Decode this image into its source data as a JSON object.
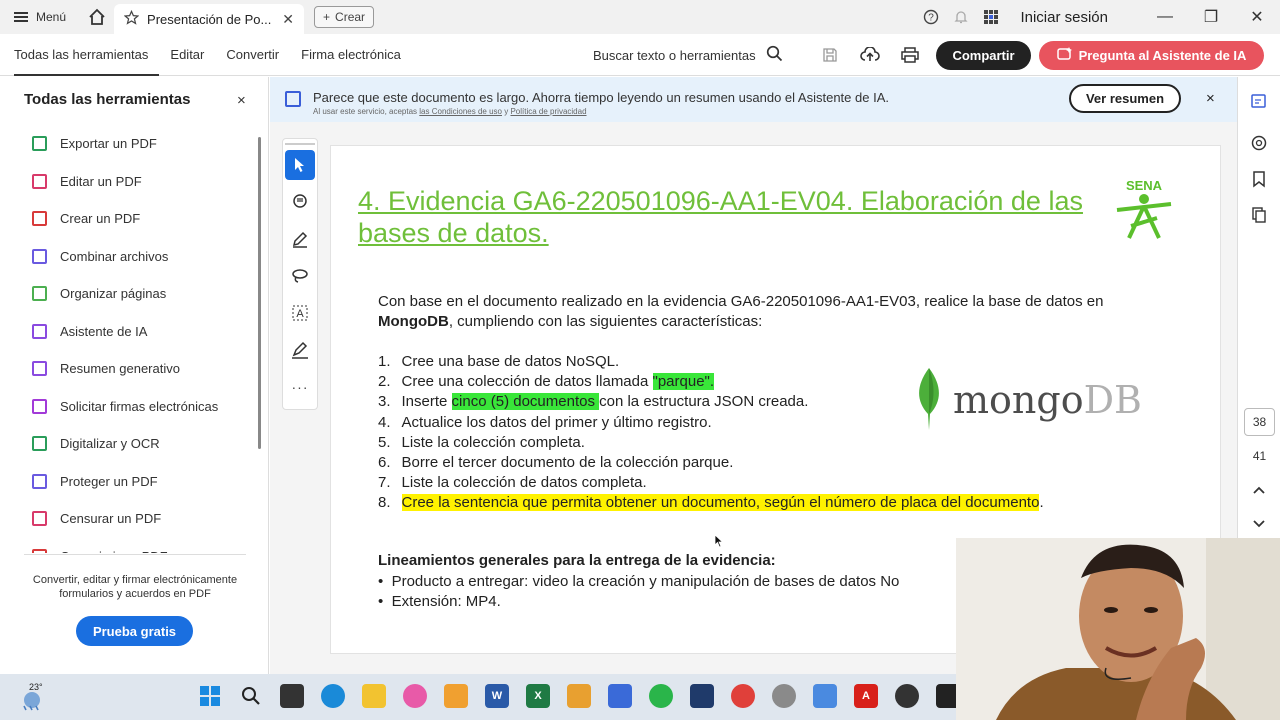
{
  "titlebar": {
    "menu_label": "Menú",
    "tab_label": "Presentación de Po...",
    "new_tab_label": "Crear",
    "signin_label": "Iniciar sesión"
  },
  "toolbar": {
    "items": [
      "Todas las herramientas",
      "Editar",
      "Convertir",
      "Firma electrónica"
    ],
    "search_label": "Buscar texto o herramientas",
    "share_label": "Compartir",
    "ai_label": "Pregunta al Asistente de IA"
  },
  "sidebar": {
    "title": "Todas las herramientas",
    "close": "×",
    "items": [
      {
        "label": "Exportar un PDF",
        "color": "#2a9d5a"
      },
      {
        "label": "Editar un PDF",
        "color": "#d83a6a"
      },
      {
        "label": "Crear un PDF",
        "color": "#d83a3a"
      },
      {
        "label": "Combinar archivos",
        "color": "#6a5ae0"
      },
      {
        "label": "Organizar páginas",
        "color": "#4caf50"
      },
      {
        "label": "Asistente de IA",
        "color": "#8a4ae0"
      },
      {
        "label": "Resumen generativo",
        "color": "#8a4ae0"
      },
      {
        "label": "Solicitar firmas electrónicas",
        "color": "#a23ad8"
      },
      {
        "label": "Digitalizar y OCR",
        "color": "#2a9d5a"
      },
      {
        "label": "Proteger un PDF",
        "color": "#6a5ae0"
      },
      {
        "label": "Censurar un PDF",
        "color": "#d83a6a"
      },
      {
        "label": "Comprimir un PDF",
        "color": "#d83a3a"
      }
    ],
    "promo_text": "Convertir, editar y firmar electrónicamente formularios y acuerdos en PDF",
    "trial_label": "Prueba gratis"
  },
  "banner": {
    "text": "Parece que este documento es largo. Ahorra tiempo leyendo un resumen usando el Asistente de IA.",
    "small_prefix": "Al usar este servicio, aceptas",
    "terms_link": "las Condiciones de uso",
    "joiner": "y",
    "privacy_link": "Política de privacidad",
    "button_label": "Ver resumen",
    "close": "×"
  },
  "document": {
    "title": "4. Evidencia GA6-220501096-AA1-EV04. Elaboración de las bases de datos.",
    "logo_text": "SENA",
    "intro_1": "Con base en el documento realizado en la evidencia GA6-220501096-AA1-EV03, realice la base de datos en ",
    "intro_bold": "MongoDB",
    "intro_2": ", cumpliendo con las siguientes características:",
    "list": [
      {
        "n": "1.",
        "pre": "Cree una base de datos NoSQL.",
        "hl": "",
        "post": "",
        "hl_color": ""
      },
      {
        "n": "2.",
        "pre": "Cree una colección de datos llamada ",
        "hl": "\"parque\".",
        "post": "",
        "hl_color": "green"
      },
      {
        "n": "3.",
        "pre": "Inserte ",
        "hl": "cinco (5) documentos ",
        "post": "con la estructura JSON creada.",
        "hl_color": "green"
      },
      {
        "n": "4.",
        "pre": "Actualice los datos del primer y último registro.",
        "hl": "",
        "post": "",
        "hl_color": ""
      },
      {
        "n": "5.",
        "pre": "Liste la colección completa.",
        "hl": "",
        "post": "",
        "hl_color": ""
      },
      {
        "n": "6.",
        "pre": "Borre el tercer documento de la colección parque.",
        "hl": "",
        "post": "",
        "hl_color": ""
      },
      {
        "n": "7.",
        "pre": "Liste la colección de datos completa.",
        "hl": "",
        "post": "",
        "hl_color": ""
      },
      {
        "n": "8.",
        "pre": "",
        "hl": "Cree la sentencia que permita obtener un documento, según el número de placa del documento",
        "post": ".",
        "hl_color": "yellow"
      }
    ],
    "mongo_word": "mongo",
    "mongo_db": "DB",
    "guides_title": "Lineamientos generales para la entrega de la evidencia:",
    "guides": [
      "Producto a entregar: video la creación y manipulación de bases de datos No",
      "Extensión: MP4."
    ]
  },
  "pager": {
    "current": "38",
    "total": "41"
  },
  "taskbar": {
    "temperature": "23°"
  },
  "colors": {
    "accent_blue": "#1a6fe0",
    "ai_red": "#e8545e",
    "title_green": "#6fbf3a",
    "highlight_green": "#39e639",
    "highlight_yellow": "#fff200"
  }
}
